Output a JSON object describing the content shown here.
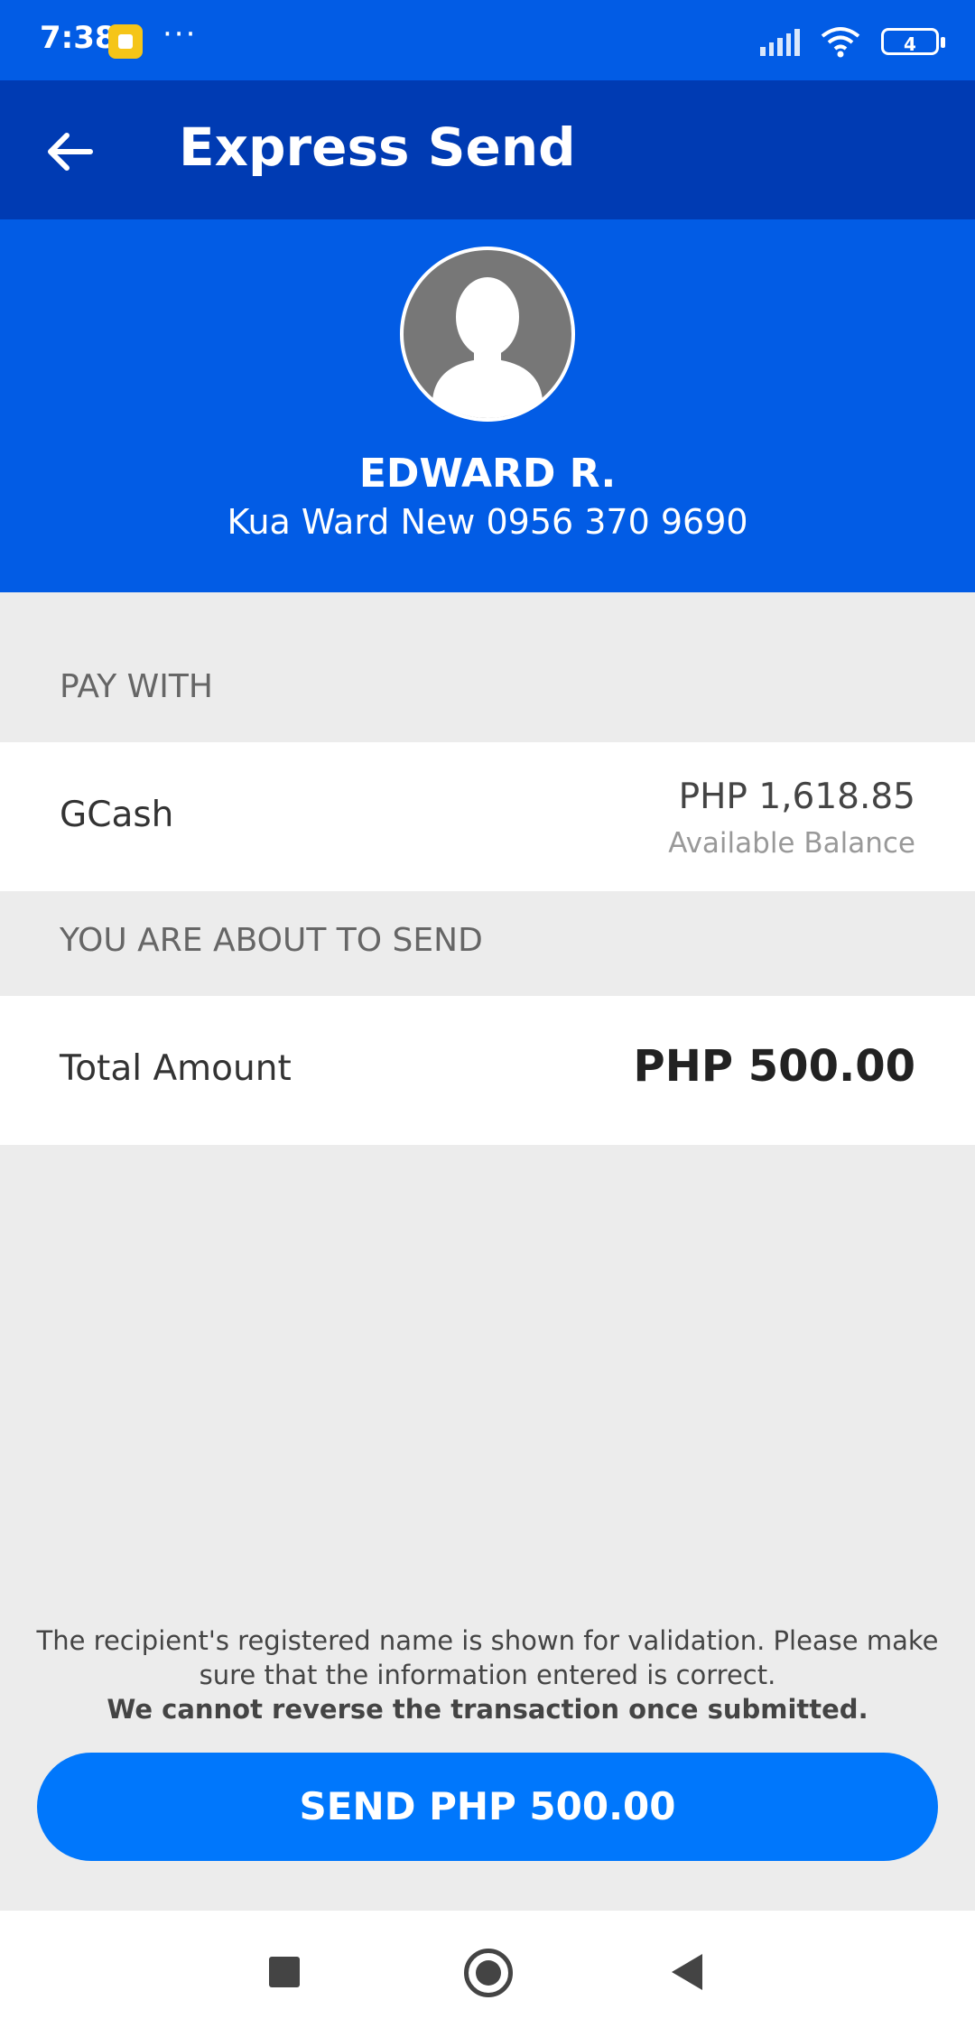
{
  "status_bar": {
    "time": "7:38",
    "more": "···",
    "battery_level": "4",
    "icons": [
      "app-notification-icon",
      "signal-icon",
      "wifi-icon",
      "battery-icon"
    ]
  },
  "app_bar": {
    "title": "Express Send",
    "back_icon": "arrow-left-icon"
  },
  "recipient": {
    "name": "EDWARD R.",
    "details": "Kua Ward New 0956 370 9690",
    "avatar_icon": "person-silhouette-icon"
  },
  "pay_with": {
    "section_label": "PAY WITH",
    "method": "GCash",
    "balance": "PHP 1,618.85",
    "balance_label": "Available Balance"
  },
  "send_summary": {
    "section_label": "YOU ARE ABOUT TO SEND",
    "total_label": "Total Amount",
    "total_value": "PHP 500.00"
  },
  "disclaimer": {
    "text": "The recipient's registered name is shown for validation. Please make sure that the information entered is correct.",
    "warning": "We cannot reverse the transaction once submitted."
  },
  "send_button": {
    "label": "SEND PHP 500.00"
  },
  "colors": {
    "primary_blue": "#025ce5",
    "app_bar_blue": "#003bb3",
    "button_blue": "#0077fc",
    "background": "#ececec"
  },
  "nav_bar": {
    "icons": [
      "recents-icon",
      "home-icon",
      "back-triangle-icon"
    ]
  }
}
